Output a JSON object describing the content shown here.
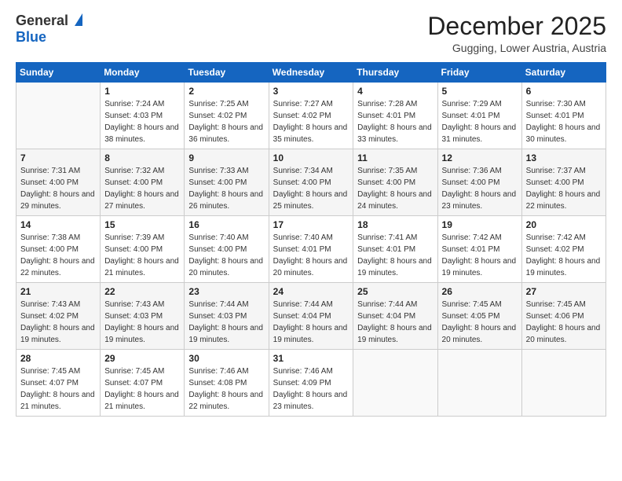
{
  "header": {
    "logo_line1": "General",
    "logo_line2": "Blue",
    "month": "December 2025",
    "location": "Gugging, Lower Austria, Austria"
  },
  "days_of_week": [
    "Sunday",
    "Monday",
    "Tuesday",
    "Wednesday",
    "Thursday",
    "Friday",
    "Saturday"
  ],
  "weeks": [
    [
      {
        "day": "",
        "info": ""
      },
      {
        "day": "1",
        "sunrise": "7:24 AM",
        "sunset": "4:03 PM",
        "daylight": "8 hours and 38 minutes."
      },
      {
        "day": "2",
        "sunrise": "7:25 AM",
        "sunset": "4:02 PM",
        "daylight": "8 hours and 36 minutes."
      },
      {
        "day": "3",
        "sunrise": "7:27 AM",
        "sunset": "4:02 PM",
        "daylight": "8 hours and 35 minutes."
      },
      {
        "day": "4",
        "sunrise": "7:28 AM",
        "sunset": "4:01 PM",
        "daylight": "8 hours and 33 minutes."
      },
      {
        "day": "5",
        "sunrise": "7:29 AM",
        "sunset": "4:01 PM",
        "daylight": "8 hours and 31 minutes."
      },
      {
        "day": "6",
        "sunrise": "7:30 AM",
        "sunset": "4:01 PM",
        "daylight": "8 hours and 30 minutes."
      }
    ],
    [
      {
        "day": "7",
        "sunrise": "7:31 AM",
        "sunset": "4:00 PM",
        "daylight": "8 hours and 29 minutes."
      },
      {
        "day": "8",
        "sunrise": "7:32 AM",
        "sunset": "4:00 PM",
        "daylight": "8 hours and 27 minutes."
      },
      {
        "day": "9",
        "sunrise": "7:33 AM",
        "sunset": "4:00 PM",
        "daylight": "8 hours and 26 minutes."
      },
      {
        "day": "10",
        "sunrise": "7:34 AM",
        "sunset": "4:00 PM",
        "daylight": "8 hours and 25 minutes."
      },
      {
        "day": "11",
        "sunrise": "7:35 AM",
        "sunset": "4:00 PM",
        "daylight": "8 hours and 24 minutes."
      },
      {
        "day": "12",
        "sunrise": "7:36 AM",
        "sunset": "4:00 PM",
        "daylight": "8 hours and 23 minutes."
      },
      {
        "day": "13",
        "sunrise": "7:37 AM",
        "sunset": "4:00 PM",
        "daylight": "8 hours and 22 minutes."
      }
    ],
    [
      {
        "day": "14",
        "sunrise": "7:38 AM",
        "sunset": "4:00 PM",
        "daylight": "8 hours and 22 minutes."
      },
      {
        "day": "15",
        "sunrise": "7:39 AM",
        "sunset": "4:00 PM",
        "daylight": "8 hours and 21 minutes."
      },
      {
        "day": "16",
        "sunrise": "7:40 AM",
        "sunset": "4:00 PM",
        "daylight": "8 hours and 20 minutes."
      },
      {
        "day": "17",
        "sunrise": "7:40 AM",
        "sunset": "4:01 PM",
        "daylight": "8 hours and 20 minutes."
      },
      {
        "day": "18",
        "sunrise": "7:41 AM",
        "sunset": "4:01 PM",
        "daylight": "8 hours and 19 minutes."
      },
      {
        "day": "19",
        "sunrise": "7:42 AM",
        "sunset": "4:01 PM",
        "daylight": "8 hours and 19 minutes."
      },
      {
        "day": "20",
        "sunrise": "7:42 AM",
        "sunset": "4:02 PM",
        "daylight": "8 hours and 19 minutes."
      }
    ],
    [
      {
        "day": "21",
        "sunrise": "7:43 AM",
        "sunset": "4:02 PM",
        "daylight": "8 hours and 19 minutes."
      },
      {
        "day": "22",
        "sunrise": "7:43 AM",
        "sunset": "4:03 PM",
        "daylight": "8 hours and 19 minutes."
      },
      {
        "day": "23",
        "sunrise": "7:44 AM",
        "sunset": "4:03 PM",
        "daylight": "8 hours and 19 minutes."
      },
      {
        "day": "24",
        "sunrise": "7:44 AM",
        "sunset": "4:04 PM",
        "daylight": "8 hours and 19 minutes."
      },
      {
        "day": "25",
        "sunrise": "7:44 AM",
        "sunset": "4:04 PM",
        "daylight": "8 hours and 19 minutes."
      },
      {
        "day": "26",
        "sunrise": "7:45 AM",
        "sunset": "4:05 PM",
        "daylight": "8 hours and 20 minutes."
      },
      {
        "day": "27",
        "sunrise": "7:45 AM",
        "sunset": "4:06 PM",
        "daylight": "8 hours and 20 minutes."
      }
    ],
    [
      {
        "day": "28",
        "sunrise": "7:45 AM",
        "sunset": "4:07 PM",
        "daylight": "8 hours and 21 minutes."
      },
      {
        "day": "29",
        "sunrise": "7:45 AM",
        "sunset": "4:07 PM",
        "daylight": "8 hours and 21 minutes."
      },
      {
        "day": "30",
        "sunrise": "7:46 AM",
        "sunset": "4:08 PM",
        "daylight": "8 hours and 22 minutes."
      },
      {
        "day": "31",
        "sunrise": "7:46 AM",
        "sunset": "4:09 PM",
        "daylight": "8 hours and 23 minutes."
      },
      {
        "day": "",
        "info": ""
      },
      {
        "day": "",
        "info": ""
      },
      {
        "day": "",
        "info": ""
      }
    ]
  ]
}
